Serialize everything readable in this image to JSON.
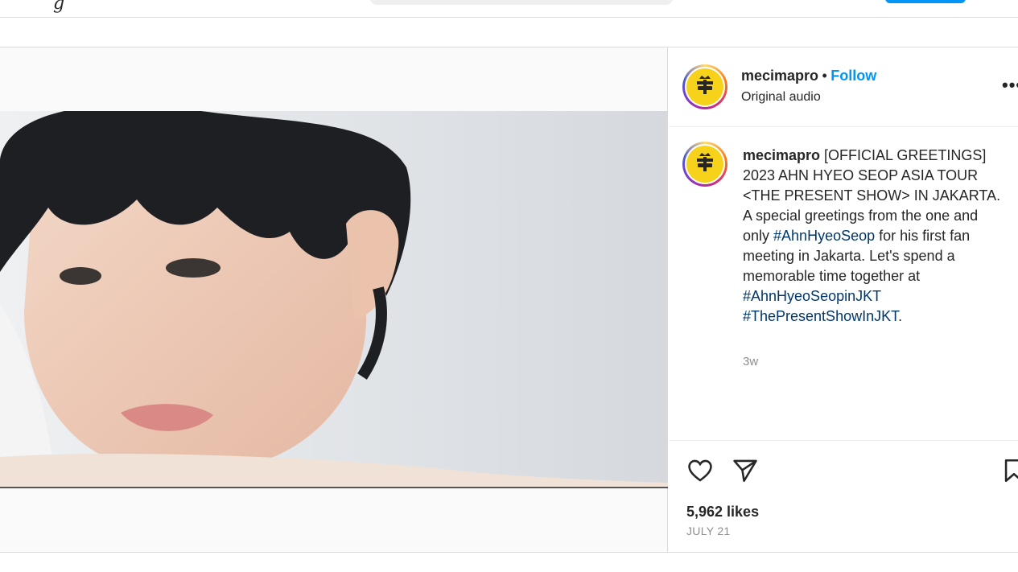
{
  "topbar": {
    "logo_fragment": "g"
  },
  "post": {
    "author": {
      "username": "mecimapro",
      "separator": "•",
      "follow_label": "Follow",
      "audio_label": "Original audio"
    },
    "caption": {
      "username": "mecimapro",
      "line1": " [OFFICIAL GREETINGS] 2023 AHN HYEO SEOP ASIA TOUR <THE PRESENT SHOW> IN JAKARTA.",
      "line2_pre": "A special greetings from the one and only ",
      "hashtag1": "#AhnHyeoSeop",
      "line2_post": " for his first fan meeting in Jakarta. Let's spend a memorable time together at ",
      "hashtag2": "#AhnHyeoSeopinJKT",
      "hashtag3": "#ThePresentShowInJKT",
      "end": ".",
      "time_ago": "3w"
    },
    "stats": {
      "likes": "5,962 likes",
      "date": "JULY 21"
    },
    "colors": {
      "follow": "#0095f6",
      "hashtag": "#00376b",
      "avatar_bg": "#f6d21a"
    }
  },
  "icons": {
    "more": "more-options-icon",
    "like": "heart-icon",
    "share": "paper-plane-icon",
    "save": "bookmark-icon",
    "audio": "speaker-icon"
  }
}
